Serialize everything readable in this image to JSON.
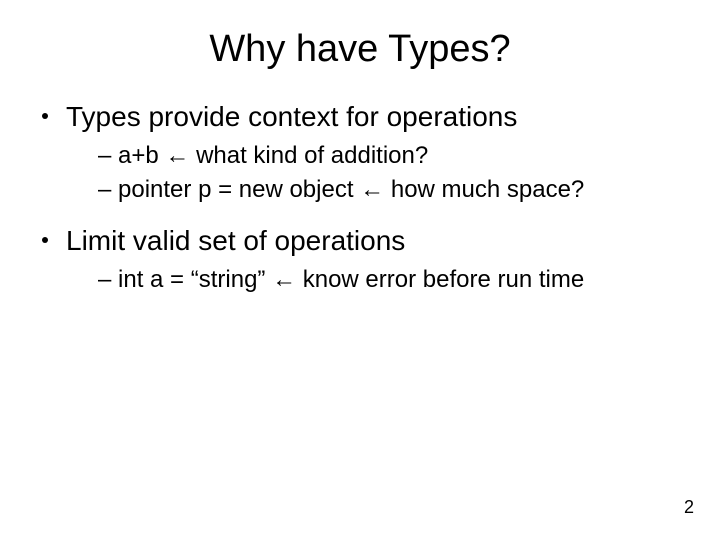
{
  "title": "Why have Types?",
  "bullets": [
    {
      "text": "Types provide context for operations",
      "subs": [
        "– a+b ← what kind of addition?",
        "– pointer p = new object ← how much space?"
      ]
    },
    {
      "text": "Limit valid set of operations",
      "subs": [
        "– int a = “string” ← know error before run time"
      ]
    }
  ],
  "pageNumber": "2"
}
